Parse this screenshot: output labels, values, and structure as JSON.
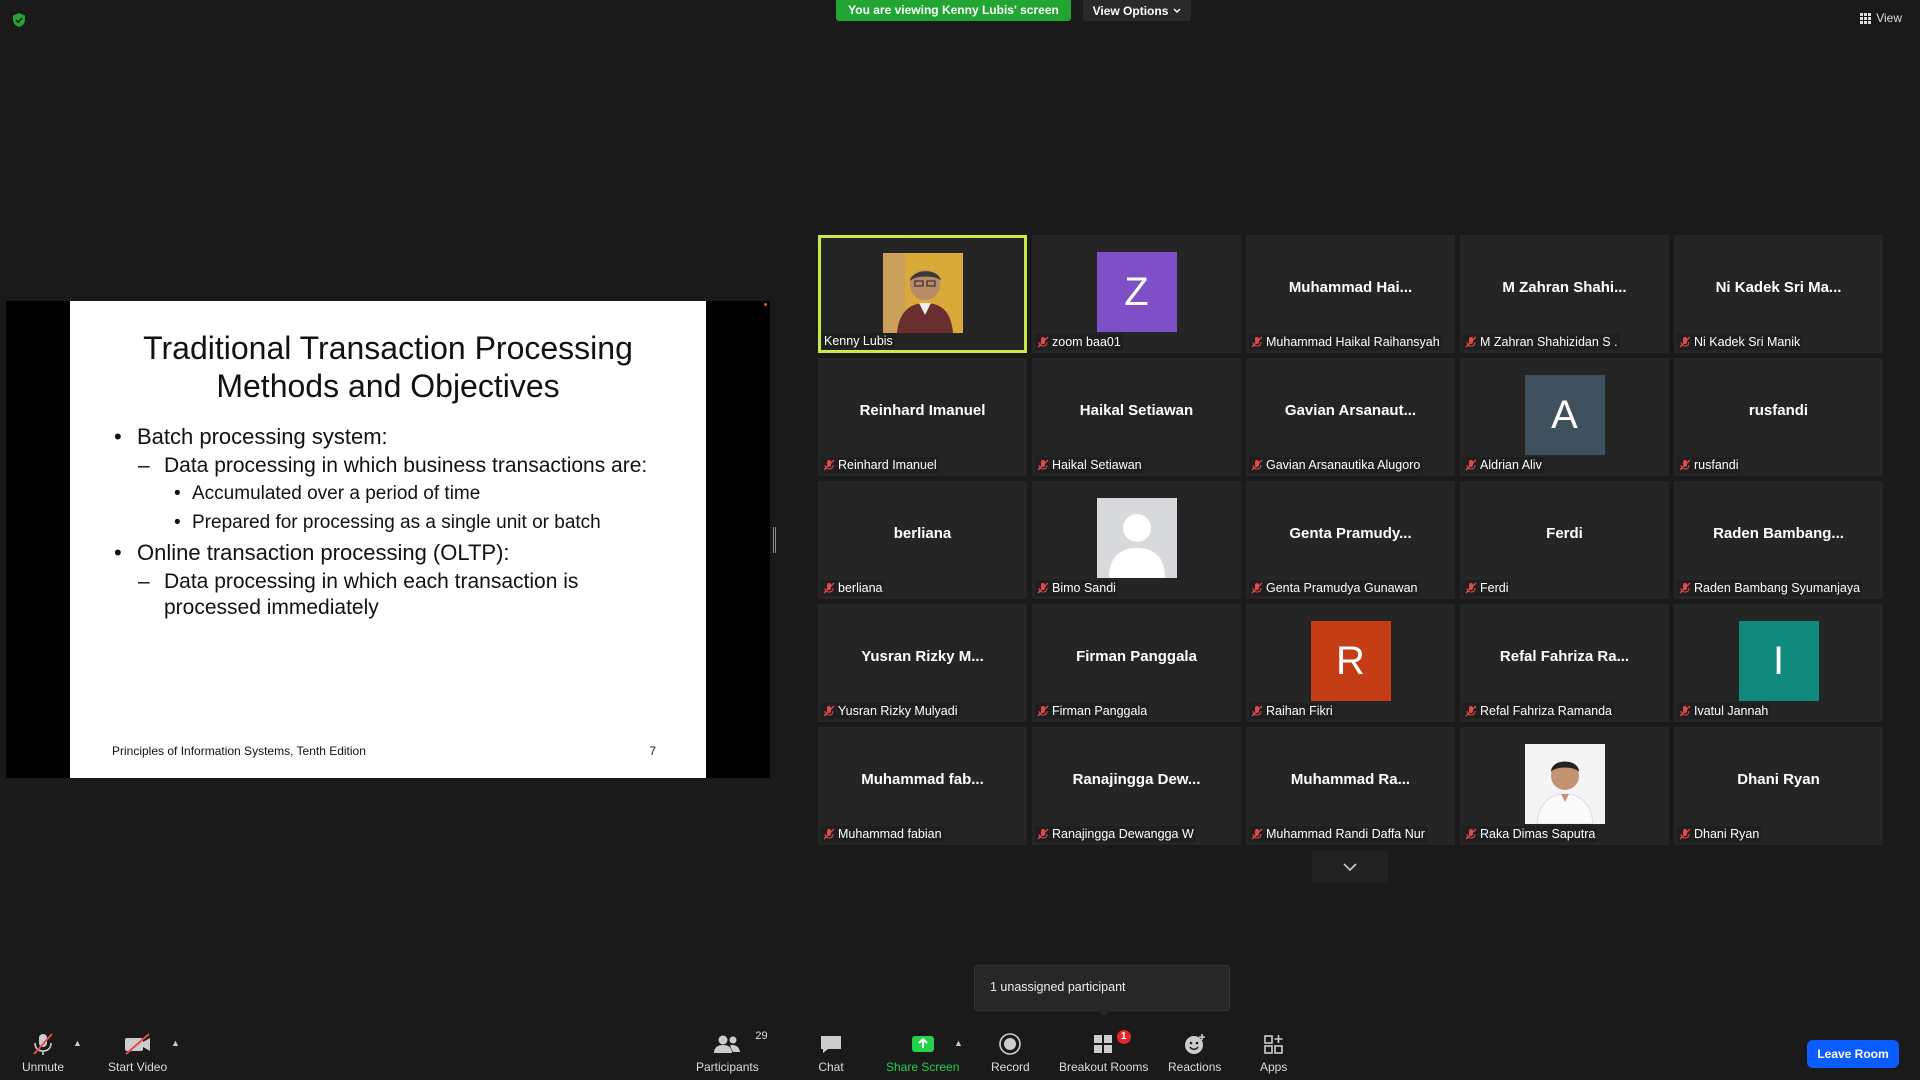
{
  "banner": {
    "viewing": "You are viewing Kenny Lubis' screen",
    "view_options": "View Options",
    "view": "View"
  },
  "slide": {
    "title_line1": "Traditional Transaction Processing",
    "title_line2": "Methods and Objectives",
    "bullet1": "Batch processing system:",
    "bullet1_sub": "Data processing in which business transactions are:",
    "bullet1_sub_a": "Accumulated over a period of time",
    "bullet1_sub_b": "Prepared for processing as a single unit or batch",
    "bullet2": "Online transaction processing (OLTP):",
    "bullet2_sub_line1": "Data processing in which each transaction is",
    "bullet2_sub_line2": "processed immediately",
    "footer": "Principles of Information Systems, Tenth Edition",
    "page": "7"
  },
  "participants_grid": [
    {
      "display": "",
      "label": "Kenny Lubis",
      "muted": false,
      "avatar": "photo-kenny",
      "active": true
    },
    {
      "display": "",
      "label": "zoom baa01",
      "muted": true,
      "avatar": "letter",
      "letter": "Z",
      "color": "#7e4fc6"
    },
    {
      "display": "Muhammad  Hai...",
      "label": "Muhammad Haikal Raihansyah",
      "muted": true
    },
    {
      "display": "M  Zahran  Shahi...",
      "label": "M Zahran Shahizidan S .",
      "muted": true
    },
    {
      "display": "Ni  Kadek  Sri  Ma...",
      "label": "Ni Kadek Sri Manik",
      "muted": true
    },
    {
      "display": "Reinhard Imanuel",
      "label": "Reinhard Imanuel",
      "muted": true
    },
    {
      "display": "Haikal Setiawan",
      "label": "Haikal Setiawan",
      "muted": true
    },
    {
      "display": "Gavian  Arsanaut...",
      "label": "Gavian Arsanautika Alugoro",
      "muted": true
    },
    {
      "display": "",
      "label": "Aldrian Aliv",
      "muted": true,
      "avatar": "letter",
      "letter": "A",
      "color": "#3f515d"
    },
    {
      "display": "rusfandi",
      "label": "rusfandi",
      "muted": true
    },
    {
      "display": "berliana",
      "label": "berliana",
      "muted": true
    },
    {
      "display": "",
      "label": "Bimo Sandi",
      "muted": true,
      "avatar": "silhouette"
    },
    {
      "display": "Genta  Pramudy...",
      "label": "Genta Pramudya Gunawan",
      "muted": true
    },
    {
      "display": "Ferdi",
      "label": "Ferdi",
      "muted": true
    },
    {
      "display": "Raden  Bambang...",
      "label": "Raden Bambang Syumanjaya",
      "muted": true
    },
    {
      "display": "Yusran  Rizky  M...",
      "label": "Yusran Rizky Mulyadi",
      "muted": true
    },
    {
      "display": "Firman Panggala",
      "label": "Firman Panggala",
      "muted": true
    },
    {
      "display": "",
      "label": "Raihan Fikri",
      "muted": true,
      "avatar": "letter",
      "letter": "R",
      "color": "#c43d14"
    },
    {
      "display": "Refal  Fahriza  Ra...",
      "label": "Refal Fahriza Ramanda",
      "muted": true
    },
    {
      "display": "",
      "label": "Ivatul Jannah",
      "muted": true,
      "avatar": "letter",
      "letter": "I",
      "color": "#118a7e"
    },
    {
      "display": "Muhammad  fab...",
      "label": "Muhammad fabian",
      "muted": true
    },
    {
      "display": "Ranajingga  Dew...",
      "label": "Ranajingga Dewangga W",
      "muted": true
    },
    {
      "display": "Muhammad  Ra...",
      "label": "Muhammad Randi Daffa Nur",
      "muted": true
    },
    {
      "display": "",
      "label": "Raka Dimas Saputra",
      "muted": true,
      "avatar": "photo-raka"
    },
    {
      "display": "Dhani Ryan",
      "label": "Dhani Ryan",
      "muted": true
    }
  ],
  "tooltip": "1 unassigned participant",
  "toolbar": {
    "unmute": "Unmute",
    "start_video": "Start Video",
    "participants": "Participants",
    "participants_count": "29",
    "chat": "Chat",
    "share_screen": "Share Screen",
    "record": "Record",
    "breakout_rooms": "Breakout Rooms",
    "breakout_badge": "1",
    "reactions": "Reactions",
    "apps": "Apps",
    "leave_room": "Leave Room"
  },
  "colors": {
    "share_green": "#23a534",
    "active_border": "#c6e94b",
    "leave_blue": "#0b5cff",
    "mute_red": "#e04a4a"
  }
}
